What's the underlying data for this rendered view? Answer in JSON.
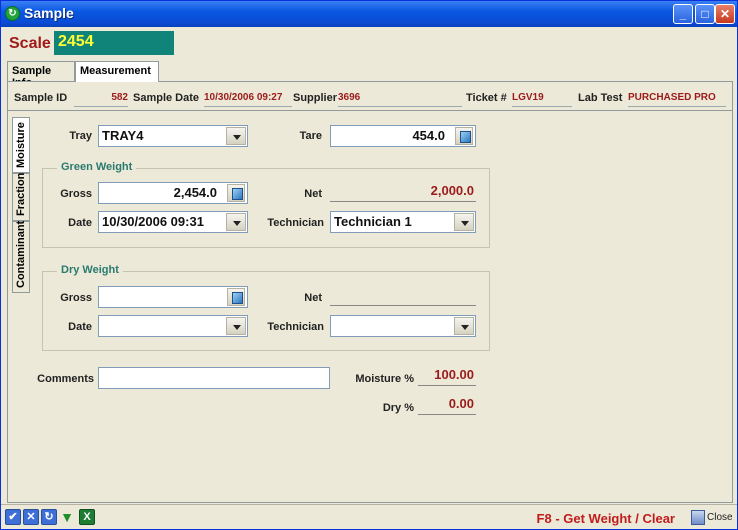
{
  "window": {
    "title": "Sample",
    "controls": {
      "minimize": "_",
      "maximize": "□",
      "close": "✕"
    }
  },
  "scale": {
    "label": "Scale",
    "value": "2454"
  },
  "tabs": [
    {
      "label": "Sample Info"
    },
    {
      "label": "Measurement"
    }
  ],
  "header": {
    "sample_id_label": "Sample ID",
    "sample_id": "582",
    "sample_date_label": "Sample Date",
    "sample_date": "10/30/2006 09:27",
    "supplier_label": "Supplier",
    "supplier": "3696",
    "ticket_label": "Ticket #",
    "ticket": "LGV19",
    "lab_test_label": "Lab Test",
    "lab_test": "PURCHASED PRO"
  },
  "side_tabs": [
    {
      "label": "Moisture"
    },
    {
      "label": "Fraction"
    },
    {
      "label": "Contaminant"
    }
  ],
  "moisture": {
    "tray_label": "Tray",
    "tray": "TRAY4",
    "tare_label": "Tare",
    "tare": "454.0",
    "green": {
      "title": "Green Weight",
      "gross_label": "Gross",
      "gross": "2,454.0",
      "net_label": "Net",
      "net": "2,000.0",
      "date_label": "Date",
      "date": "10/30/2006 09:31",
      "technician_label": "Technician",
      "technician": "Technician 1"
    },
    "dry": {
      "title": "Dry Weight",
      "gross_label": "Gross",
      "gross": "",
      "net_label": "Net",
      "net": "",
      "date_label": "Date",
      "date": "",
      "technician_label": "Technician",
      "technician": ""
    },
    "comments_label": "Comments",
    "comments": "",
    "moisture_pct_label": "Moisture %",
    "moisture_pct": "100.00",
    "dry_pct_label": "Dry %",
    "dry_pct": "0.00"
  },
  "statusbar": {
    "icons": [
      "check-icon",
      "cancel-icon",
      "refresh-icon",
      "filter-icon",
      "excel-icon"
    ],
    "hint": "F8 - Get Weight / Clear",
    "close_label": "Close"
  }
}
